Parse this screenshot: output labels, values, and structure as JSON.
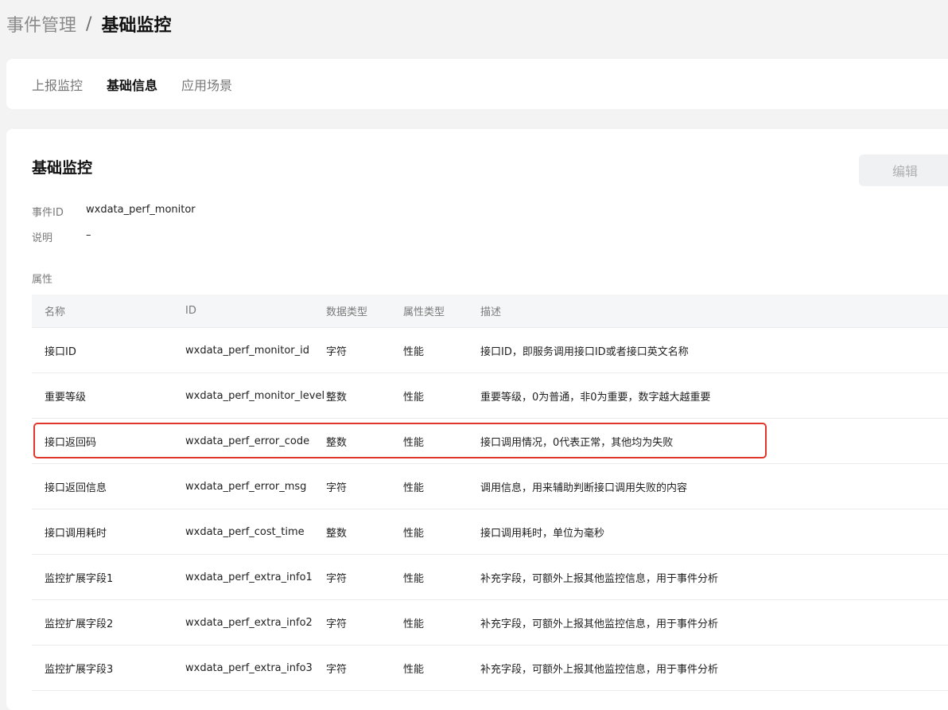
{
  "breadcrumb": {
    "parent": "事件管理",
    "separator": "/",
    "current": "基础监控"
  },
  "tabs": [
    {
      "label": "上报监控",
      "active": false
    },
    {
      "label": "基础信息",
      "active": true
    },
    {
      "label": "应用场景",
      "active": false
    }
  ],
  "section": {
    "title": "基础监控",
    "edit_label": "编辑"
  },
  "meta": {
    "event_id_label": "事件ID",
    "event_id_value": "wxdata_perf_monitor",
    "desc_label": "说明",
    "desc_value": "–"
  },
  "attributes_label": "属性",
  "table": {
    "headers": {
      "name": "名称",
      "id": "ID",
      "dtype": "数据类型",
      "ptype": "属性类型",
      "desc": "描述"
    },
    "rows": [
      {
        "name": "接口ID",
        "id": "wxdata_perf_monitor_id",
        "dtype": "字符",
        "ptype": "性能",
        "desc": "接口ID，即服务调用接口ID或者接口英文名称"
      },
      {
        "name": "重要等级",
        "id": "wxdata_perf_monitor_level",
        "dtype": "整数",
        "ptype": "性能",
        "desc": "重要等级，0为普通，非0为重要，数字越大越重要"
      },
      {
        "name": "接口返回码",
        "id": "wxdata_perf_error_code",
        "dtype": "整数",
        "ptype": "性能",
        "desc": "接口调用情况，0代表正常，其他均为失败"
      },
      {
        "name": "接口返回信息",
        "id": "wxdata_perf_error_msg",
        "dtype": "字符",
        "ptype": "性能",
        "desc": "调用信息，用来辅助判断接口调用失败的内容"
      },
      {
        "name": "接口调用耗时",
        "id": "wxdata_perf_cost_time",
        "dtype": "整数",
        "ptype": "性能",
        "desc": "接口调用耗时，单位为毫秒"
      },
      {
        "name": "监控扩展字段1",
        "id": "wxdata_perf_extra_info1",
        "dtype": "字符",
        "ptype": "性能",
        "desc": "补充字段，可额外上报其他监控信息，用于事件分析"
      },
      {
        "name": "监控扩展字段2",
        "id": "wxdata_perf_extra_info2",
        "dtype": "字符",
        "ptype": "性能",
        "desc": "补充字段，可额外上报其他监控信息，用于事件分析"
      },
      {
        "name": "监控扩展字段3",
        "id": "wxdata_perf_extra_info3",
        "dtype": "字符",
        "ptype": "性能",
        "desc": "补充字段，可额外上报其他监控信息，用于事件分析"
      }
    ]
  },
  "highlight": {
    "row": "接口返回码",
    "color": "#e0362c"
  }
}
